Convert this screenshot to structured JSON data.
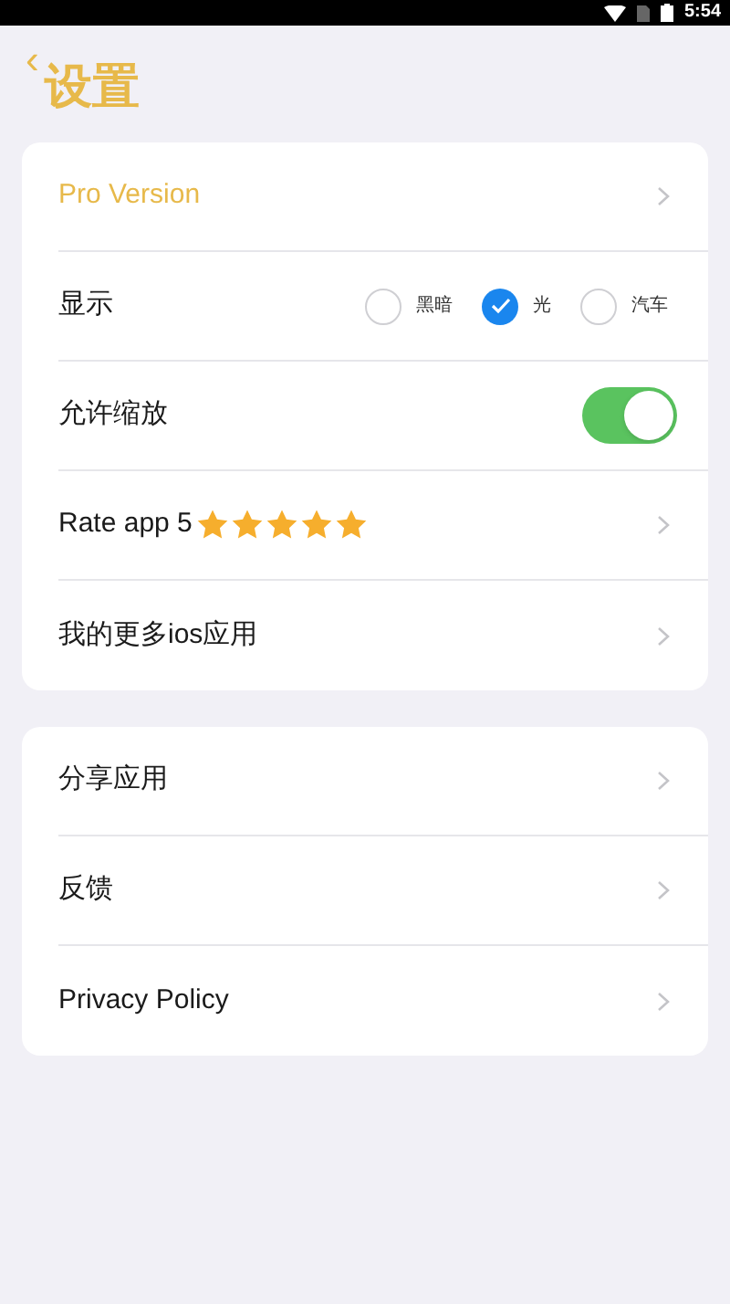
{
  "status_bar": {
    "time": "5:54"
  },
  "header": {
    "back": "‹",
    "title": "设置"
  },
  "groups": [
    {
      "rows": [
        {
          "kind": "pro",
          "label": "Pro Version"
        },
        {
          "kind": "radio",
          "label": "显示",
          "options": [
            {
              "label": "黑暗",
              "selected": false
            },
            {
              "label": "光",
              "selected": true
            },
            {
              "label": "汽车",
              "selected": false
            }
          ]
        },
        {
          "kind": "toggle",
          "label": "允许缩放",
          "on": true
        },
        {
          "kind": "rating",
          "label": "Rate app 5",
          "stars": 5
        },
        {
          "kind": "link",
          "label": "我的更多ios应用"
        }
      ]
    },
    {
      "rows": [
        {
          "kind": "link",
          "label": "分享应用"
        },
        {
          "kind": "link",
          "label": "反馈"
        },
        {
          "kind": "link",
          "label": "Privacy Policy"
        }
      ]
    }
  ]
}
